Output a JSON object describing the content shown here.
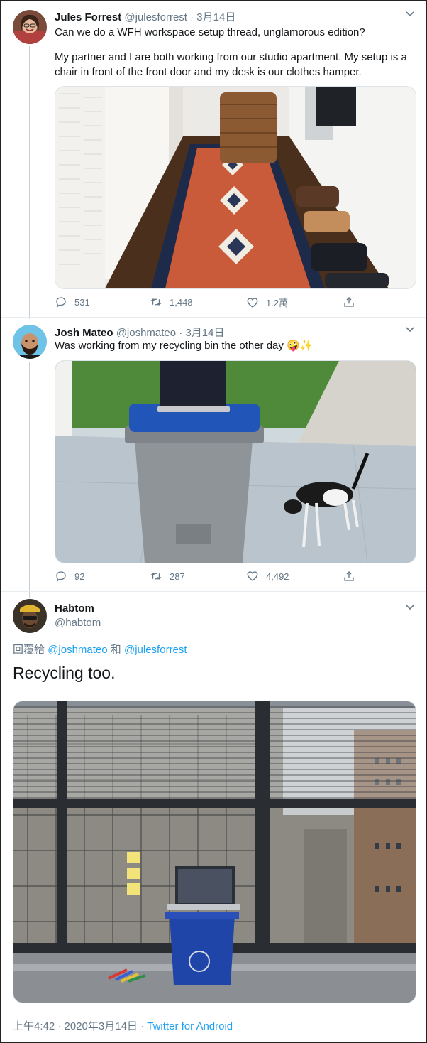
{
  "tweets": [
    {
      "name": "Jules Forrest",
      "meta": "@julesforrest · 3月14日",
      "text1": "Can we do a WFH workspace setup thread, unglamorous edition?",
      "text2": "My partner and I are both working from our studio apartment. My setup is a chair in front of the front door and my desk is our clothes hamper.",
      "actions": {
        "replies": "531",
        "retweets": "1,448",
        "likes": "1.2萬"
      }
    },
    {
      "name": "Josh Mateo",
      "meta": "@joshmateo · 3月14日",
      "text1": "Was working from my recycling bin the other day 🤪✨",
      "actions": {
        "replies": "92",
        "retweets": "287",
        "likes": "4,492"
      }
    }
  ],
  "main": {
    "name": "Habtom",
    "handle": "@habtom",
    "reply_prefix": "回覆給",
    "reply_user1": "@joshmateo",
    "reply_joiner": "和",
    "reply_user2": "@julesforrest",
    "text": "Recycling too.",
    "timestamp": "上午4:42 · 2020年3月14日 ·",
    "source": "Twitter for Android"
  },
  "colors": {
    "link": "#1da1f2",
    "muted": "#657786",
    "text": "#14171a"
  },
  "icons": [
    "reply-icon",
    "retweet-icon",
    "like-icon",
    "share-icon",
    "chevron-down-icon"
  ]
}
